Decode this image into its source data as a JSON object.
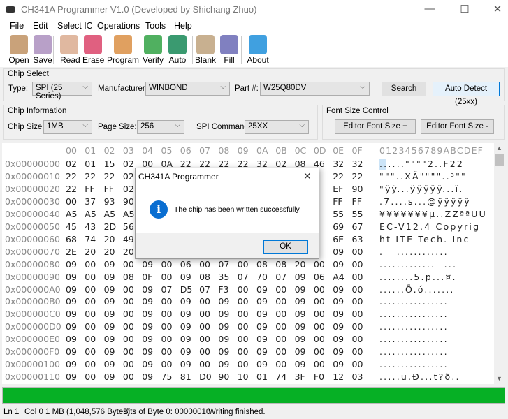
{
  "window": {
    "title": "CH341A Programmer V1.0 (Developed by Shichang Zhuo)",
    "minimize": "—",
    "maximize": "☐",
    "close": "✕"
  },
  "menu": [
    "File",
    "Edit",
    "Select IC",
    "Operations",
    "Tools",
    "Help"
  ],
  "toolbar": [
    {
      "label": "Open",
      "icon": "folder-icon",
      "color": "#c9a27a"
    },
    {
      "label": "Save",
      "icon": "floppy-icon",
      "color": "#b8a0c8"
    },
    {
      "label": "Read",
      "icon": "book-icon",
      "color": "#e0b8a0"
    },
    {
      "label": "Erase",
      "icon": "eraser-icon",
      "color": "#e06080"
    },
    {
      "label": "Program",
      "icon": "pencil-icon",
      "color": "#e0a060"
    },
    {
      "label": "Verify",
      "icon": "document-check-icon",
      "color": "#50b060"
    },
    {
      "label": "Auto",
      "icon": "gear-chip-icon",
      "color": "#3a9a70"
    },
    {
      "label": "Blank",
      "icon": "blank-sheet-icon",
      "color": "#c8b090"
    },
    {
      "label": "Fill",
      "icon": "paint-bucket-icon",
      "color": "#8080c0"
    },
    {
      "label": "About",
      "icon": "info-bubble-icon",
      "color": "#40a0e0"
    }
  ],
  "chip_select": {
    "title": "Chip Select",
    "type_label": "Type:",
    "type": "SPI (25 Series)",
    "manufacturer_label": "Manufacturer:",
    "manufacturer": "WINBOND",
    "part_label": "Part #:",
    "part": "W25Q80DV",
    "search": "Search",
    "auto_detect": "Auto Detect (25xx)"
  },
  "chip_info": {
    "title": "Chip Information",
    "size_label": "Chip Size:",
    "size": "1MB",
    "page_label": "Page Size:",
    "page": "256",
    "cmd_label": "SPI Command:",
    "cmd": "25XX"
  },
  "font_ctrl": {
    "title": "Font Size Control",
    "plus": "Editor Font Size +",
    "minus": "Editor Font Size -"
  },
  "hex": {
    "header": [
      "00",
      "01",
      "02",
      "03",
      "04",
      "05",
      "06",
      "07",
      "08",
      "09",
      "0A",
      "0B",
      "0C",
      "0D",
      "0E",
      "0F"
    ],
    "ascii_header": "0123456789ABCDEF",
    "rows": [
      {
        "offset": "0x00000000",
        "bytes": [
          "02",
          "01",
          "15",
          "02",
          "00",
          "0A",
          "22",
          "22",
          "22",
          "22",
          "32",
          "02",
          "08",
          "46",
          "32",
          "32"
        ],
        "ascii": "......\"\"\"\"2..F22"
      },
      {
        "offset": "0x00000010",
        "bytes": [
          "22",
          "22",
          "22",
          "02",
          "",
          "",
          "",
          "",
          "",
          "",
          "",
          "",
          "",
          "",
          "22",
          "22"
        ],
        "ascii": "\"\"\"..XÃ\"\"\"\"..³\"\""
      },
      {
        "offset": "0x00000020",
        "bytes": [
          "22",
          "FF",
          "FF",
          "02",
          "",
          "",
          "",
          "",
          "",
          "",
          "",
          "",
          "",
          "",
          "EF",
          "90"
        ],
        "ascii": "\"ÿÿ...ÿÿÿÿÿ...ï."
      },
      {
        "offset": "0x00000030",
        "bytes": [
          "00",
          "37",
          "93",
          "90",
          "",
          "",
          "",
          "",
          "",
          "",
          "",
          "",
          "",
          "",
          "FF",
          "FF"
        ],
        "ascii": ".7....s...@ÿÿÿÿÿ"
      },
      {
        "offset": "0x00000040",
        "bytes": [
          "A5",
          "A5",
          "A5",
          "A5",
          "",
          "",
          "",
          "",
          "",
          "",
          "",
          "",
          "",
          "",
          "55",
          "55"
        ],
        "ascii": "¥¥¥¥¥¥¥µ..ZZªªUU"
      },
      {
        "offset": "0x00000050",
        "bytes": [
          "45",
          "43",
          "2D",
          "56",
          "",
          "",
          "",
          "",
          "",
          "",
          "",
          "",
          "",
          "",
          "69",
          "67"
        ],
        "ascii": "EC-V12.4 Copyrig"
      },
      {
        "offset": "0x00000060",
        "bytes": [
          "68",
          "74",
          "20",
          "49",
          "",
          "",
          "",
          "",
          "",
          "",
          "",
          "",
          "",
          "",
          "6E",
          "63"
        ],
        "ascii": "ht ITE Tech. Inc"
      },
      {
        "offset": "0x00000070",
        "bytes": [
          "2E",
          "20",
          "20",
          "20",
          "",
          "",
          "",
          "",
          "",
          "",
          "",
          "",
          "",
          "",
          "09",
          "00"
        ],
        "ascii": ".   ............"
      },
      {
        "offset": "0x00000080",
        "bytes": [
          "09",
          "00",
          "09",
          "00",
          "09",
          "00",
          "06",
          "00",
          "07",
          "00",
          "08",
          "08",
          "20",
          "00",
          "09",
          "00"
        ],
        "ascii": ".............  ..."
      },
      {
        "offset": "0x00000090",
        "bytes": [
          "09",
          "00",
          "09",
          "08",
          "0F",
          "00",
          "09",
          "08",
          "35",
          "07",
          "70",
          "07",
          "09",
          "06",
          "A4",
          "00"
        ],
        "ascii": "........5.p...¤."
      },
      {
        "offset": "0x000000A0",
        "bytes": [
          "09",
          "00",
          "09",
          "00",
          "09",
          "07",
          "D5",
          "07",
          "F3",
          "00",
          "09",
          "00",
          "09",
          "00",
          "09",
          "00"
        ],
        "ascii": "......Õ.ó......."
      },
      {
        "offset": "0x000000B0",
        "bytes": [
          "09",
          "00",
          "09",
          "00",
          "09",
          "00",
          "09",
          "00",
          "09",
          "00",
          "09",
          "00",
          "09",
          "00",
          "09",
          "00"
        ],
        "ascii": "................"
      },
      {
        "offset": "0x000000C0",
        "bytes": [
          "09",
          "00",
          "09",
          "00",
          "09",
          "00",
          "09",
          "00",
          "09",
          "00",
          "09",
          "00",
          "09",
          "00",
          "09",
          "00"
        ],
        "ascii": "................"
      },
      {
        "offset": "0x000000D0",
        "bytes": [
          "09",
          "00",
          "09",
          "00",
          "09",
          "00",
          "09",
          "00",
          "09",
          "00",
          "09",
          "00",
          "09",
          "00",
          "09",
          "00"
        ],
        "ascii": "................"
      },
      {
        "offset": "0x000000E0",
        "bytes": [
          "09",
          "00",
          "09",
          "00",
          "09",
          "00",
          "09",
          "00",
          "09",
          "00",
          "09",
          "00",
          "09",
          "00",
          "09",
          "00"
        ],
        "ascii": "................"
      },
      {
        "offset": "0x000000F0",
        "bytes": [
          "09",
          "00",
          "09",
          "00",
          "09",
          "00",
          "09",
          "00",
          "09",
          "00",
          "09",
          "00",
          "09",
          "00",
          "09",
          "00"
        ],
        "ascii": "................"
      },
      {
        "offset": "0x00000100",
        "bytes": [
          "09",
          "00",
          "09",
          "00",
          "09",
          "00",
          "09",
          "00",
          "09",
          "00",
          "09",
          "00",
          "09",
          "00",
          "09",
          "00"
        ],
        "ascii": "................"
      },
      {
        "offset": "0x00000110",
        "bytes": [
          "09",
          "00",
          "09",
          "00",
          "09",
          "75",
          "81",
          "D0",
          "90",
          "10",
          "01",
          "74",
          "3F",
          "F0",
          "12",
          "03"
        ],
        "ascii": ".....u.Ð...t?ð.."
      }
    ]
  },
  "progress": {
    "percent": 100,
    "color": "#06b025"
  },
  "status": {
    "line": "Ln 1",
    "col": "Col 0",
    "size": "1 MB (1,048,576 Bytes)",
    "bits": "Bits of Byte 0: 00000010",
    "message": "Writing finished."
  },
  "dialog": {
    "title": "CH341A Programmer",
    "message": "The chip has been written successfully.",
    "ok": "OK",
    "close": "✕",
    "icon": "info-icon",
    "icon_color": "#0a6ed1"
  }
}
